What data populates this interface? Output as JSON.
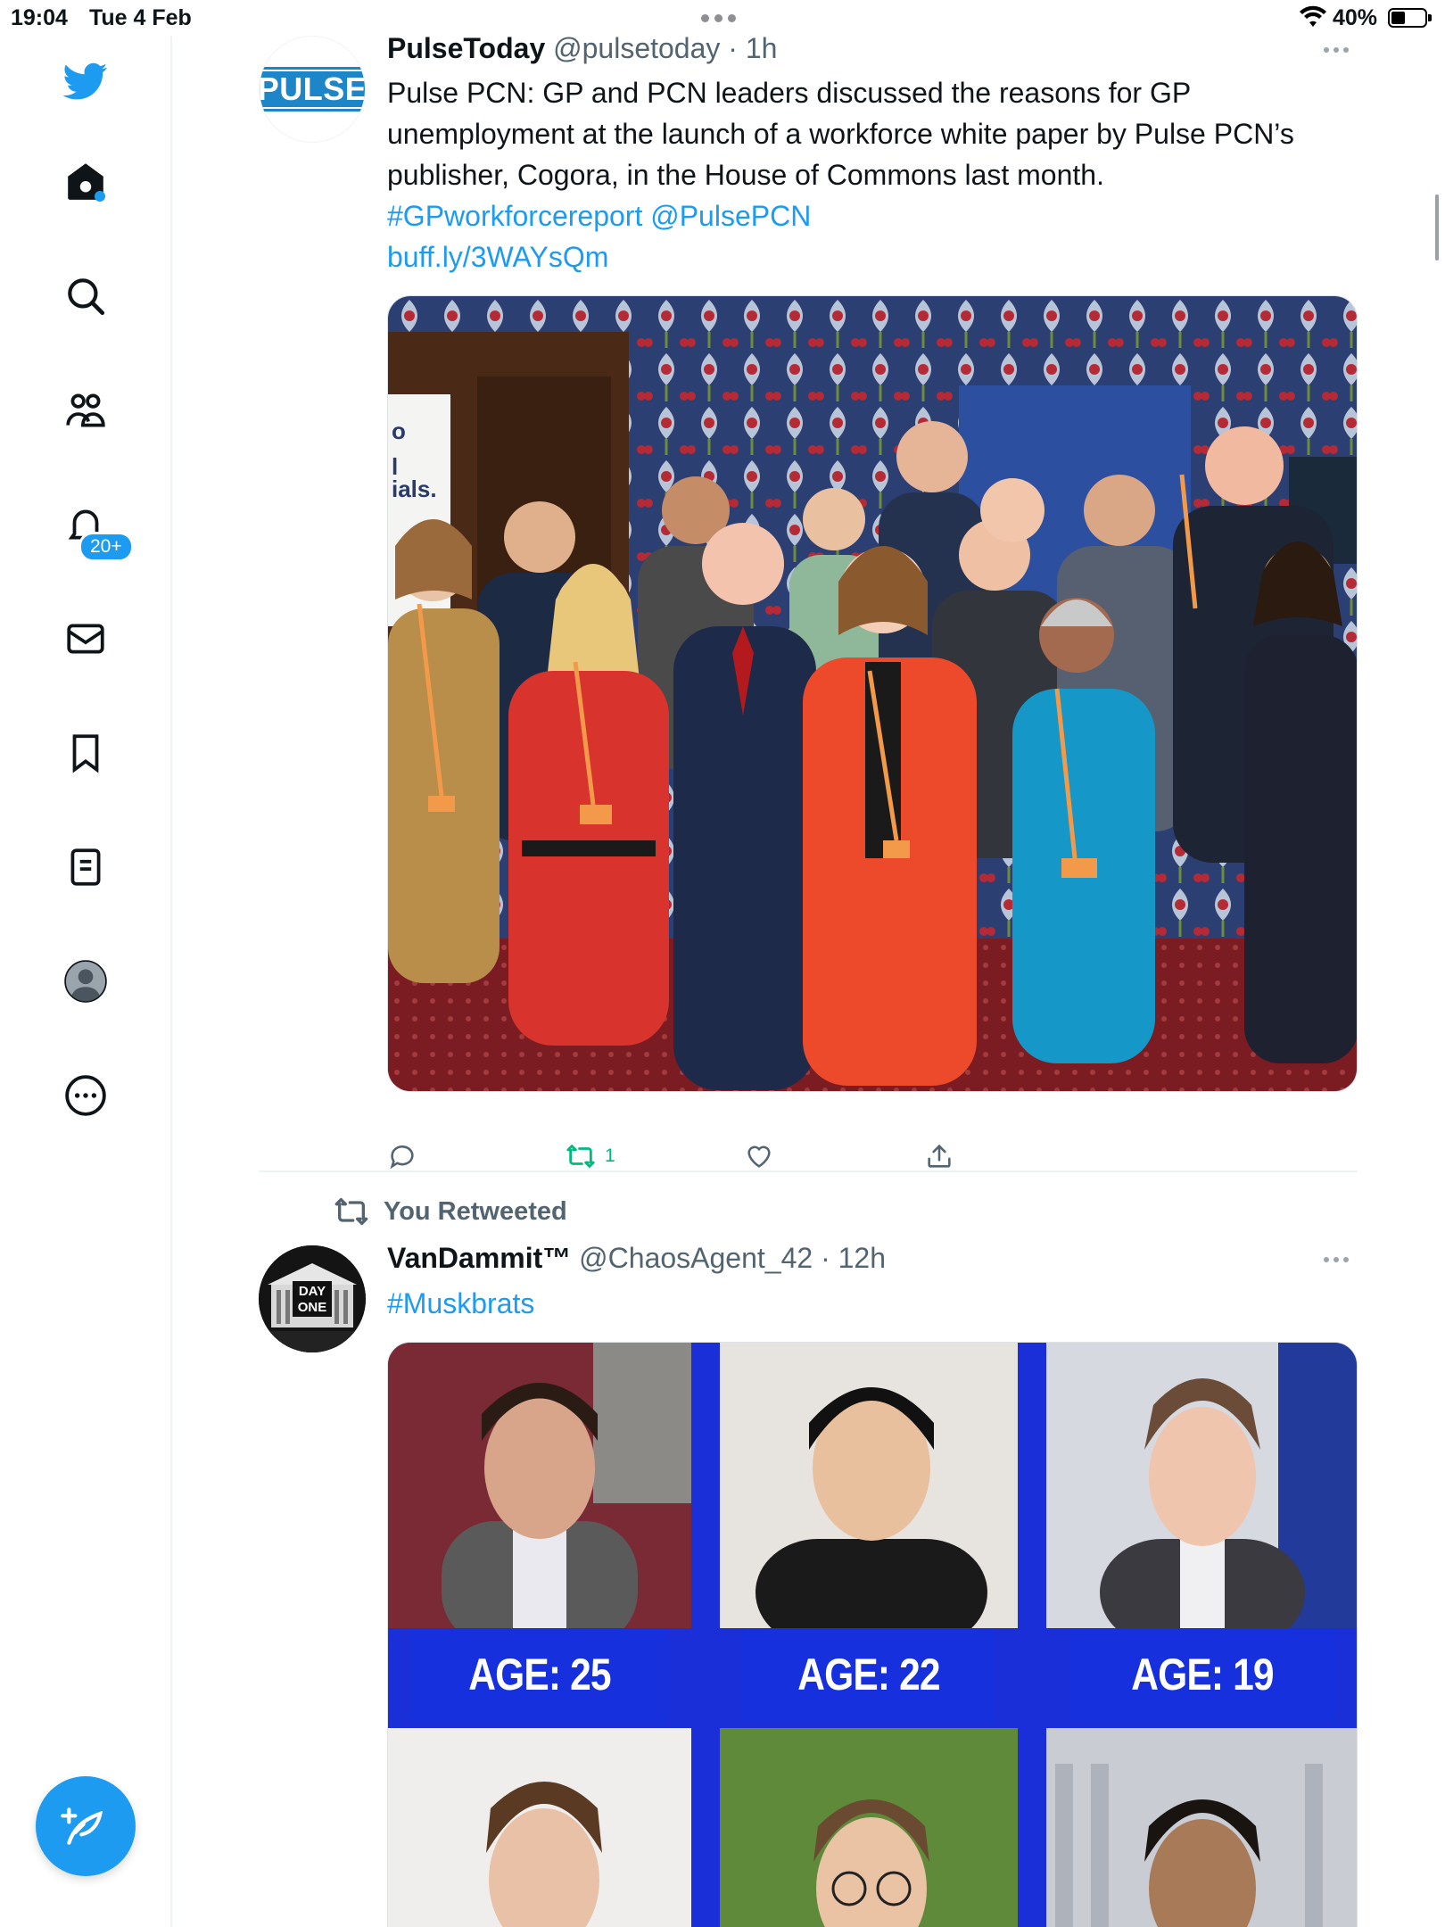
{
  "status_bar": {
    "time": "19:04",
    "date": "Tue 4 Feb",
    "battery_percent": "40%",
    "battery_level": 0.4
  },
  "sidebar": {
    "items": [
      {
        "id": "logo",
        "icon": "twitter-bird-icon"
      },
      {
        "id": "home",
        "icon": "home-icon",
        "has_dot": true
      },
      {
        "id": "explore",
        "icon": "search-icon"
      },
      {
        "id": "communities",
        "icon": "communities-icon"
      },
      {
        "id": "notifications",
        "icon": "bell-icon",
        "badge": "20+"
      },
      {
        "id": "messages",
        "icon": "mail-icon"
      },
      {
        "id": "bookmarks",
        "icon": "bookmark-icon"
      },
      {
        "id": "lists",
        "icon": "lists-icon"
      },
      {
        "id": "profile",
        "icon": "avatar-icon"
      },
      {
        "id": "more",
        "icon": "more-circle-icon"
      }
    ],
    "compose_icon": "compose-feather-icon"
  },
  "timeline": {
    "tweet1": {
      "avatar_text": "PULSE",
      "display_name": "PulseToday",
      "handle_time": "@pulsetoday · 1h",
      "text": "Pulse PCN: GP and PCN leaders discussed the reasons for GP unemployment at the launch of a workforce white paper by Pulse PCN’s publisher, Cogora, in the House of Commons last month.",
      "hashtag": "#GPworkforcereport",
      "mention": "@PulsePCN",
      "link": "buff.ly/3WAYsQm",
      "image_sign_text": "o\nl\nials.",
      "retweet_count": "1",
      "colors": {
        "retweeted": "#00ba7c",
        "link": "#1d9bf0"
      }
    },
    "retweet_context": "You Retweeted",
    "tweet2": {
      "avatar_text_top": "DAY",
      "avatar_text_bottom": "ONE",
      "display_name": "VanDammit™",
      "handle_time": "@ChaosAgent_42 · 12h",
      "hashtag": "#Muskbrats",
      "image_labels": [
        "AGE: 25",
        "AGE: 22",
        "AGE: 19"
      ]
    }
  }
}
